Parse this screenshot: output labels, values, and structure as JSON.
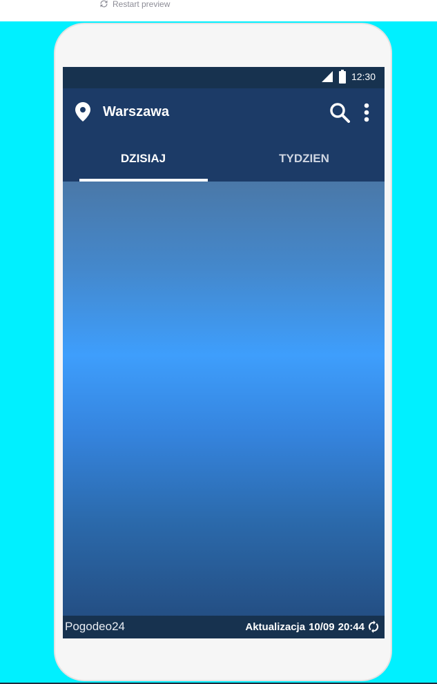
{
  "preview": {
    "restart_label": "Restart preview",
    "icon": "refresh-icon"
  },
  "status_bar": {
    "time": "12:30",
    "icons": [
      "signal-icon",
      "battery-icon"
    ]
  },
  "app_bar": {
    "location_icon": "location-pin-icon",
    "city": "Warszawa",
    "actions": [
      "search-icon",
      "more-vert-icon"
    ]
  },
  "tabs": [
    {
      "label": "DZISIAJ",
      "active": true
    },
    {
      "label": "TYDZIEN",
      "active": false
    }
  ],
  "footer": {
    "brand": "Pogodeo24",
    "update_label": "Aktualizacja",
    "date": "10/09",
    "time": "20:44",
    "refresh_icon": "sync-icon"
  },
  "colors": {
    "stage_background": "#00f0ff",
    "app_bar": "#1c3b67",
    "status_bar": "#17324f",
    "gradient_top": "#4a78a8",
    "gradient_mid": "#3e9efc",
    "gradient_bottom": "#244f84"
  }
}
